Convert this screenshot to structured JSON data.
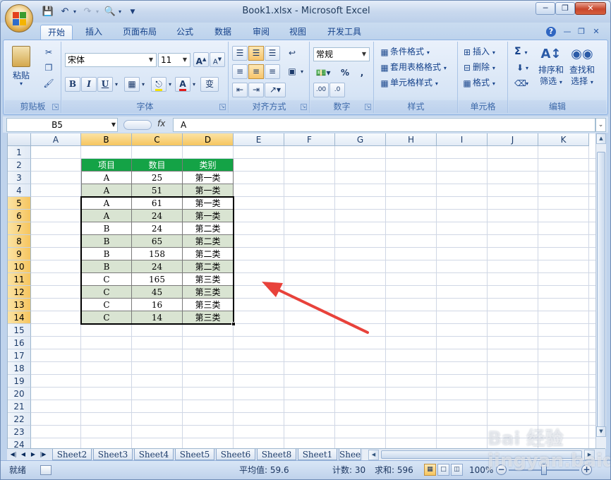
{
  "window": {
    "title": "Book1.xlsx - Microsoft Excel",
    "min_icon": "minimize-icon",
    "max_icon": "restore-icon",
    "close_icon": "close-icon"
  },
  "tabs": [
    {
      "label": "开始",
      "active": true
    },
    {
      "label": "插入"
    },
    {
      "label": "页面布局"
    },
    {
      "label": "公式"
    },
    {
      "label": "数据"
    },
    {
      "label": "审阅"
    },
    {
      "label": "视图"
    },
    {
      "label": "开发工具"
    }
  ],
  "ribbon": {
    "clipboard": {
      "label": "剪贴板",
      "paste": "粘贴"
    },
    "font": {
      "label": "字体",
      "name": "宋体",
      "size": "11",
      "bold": "B",
      "italic": "I",
      "underline": "U",
      "grow": "A",
      "shrink": "A",
      "font_color": "A",
      "phonetic": "变"
    },
    "alignment": {
      "label": "对齐方式"
    },
    "number": {
      "label": "数字",
      "format": "常规",
      "percent": "%",
      "comma": ","
    },
    "styles": {
      "label": "样式",
      "conditional": "条件格式",
      "table": "套用表格格式",
      "cell_styles": "单元格样式"
    },
    "cells": {
      "label": "单元格",
      "insert": "插入",
      "delete": "删除",
      "format": "格式"
    },
    "editing": {
      "label": "编辑",
      "sort": "排序和",
      "sort2": "筛选",
      "find": "查找和",
      "find2": "选择",
      "sigma": "Σ"
    }
  },
  "formula_bar": {
    "name_box": "B5",
    "fx": "fx",
    "value": "A"
  },
  "columns": [
    "A",
    "B",
    "C",
    "D",
    "E",
    "F",
    "G",
    "H",
    "I",
    "J",
    "K"
  ],
  "rows": [
    "1",
    "2",
    "3",
    "4",
    "5",
    "6",
    "7",
    "8",
    "9",
    "10",
    "11",
    "12",
    "13",
    "14",
    "15",
    "16",
    "17",
    "18",
    "19",
    "20",
    "21",
    "22",
    "23",
    "24"
  ],
  "table": {
    "headers": [
      "项目",
      "数目",
      "类别"
    ],
    "rows": [
      [
        "A",
        "25",
        "第一类"
      ],
      [
        "A",
        "51",
        "第一类"
      ],
      [
        "A",
        "61",
        "第一类"
      ],
      [
        "A",
        "24",
        "第一类"
      ],
      [
        "B",
        "24",
        "第二类"
      ],
      [
        "B",
        "65",
        "第二类"
      ],
      [
        "B",
        "158",
        "第二类"
      ],
      [
        "B",
        "24",
        "第二类"
      ],
      [
        "C",
        "165",
        "第三类"
      ],
      [
        "C",
        "45",
        "第三类"
      ],
      [
        "C",
        "16",
        "第三类"
      ],
      [
        "C",
        "14",
        "第三类"
      ]
    ],
    "header_color": "#14a346",
    "band_color": "#d9e4d2"
  },
  "sheets": [
    "Sheet2",
    "Sheet3",
    "Sheet4",
    "Sheet5",
    "Sheet6",
    "Sheet8",
    "Sheet1",
    "Shee"
  ],
  "status": {
    "ready": "就绪",
    "average": "平均值: 59.6",
    "count": "计数: 30",
    "sum": "求和: 596",
    "zoom": "100%"
  },
  "watermark": "Bai 经验 jingyan.baidu.com"
}
